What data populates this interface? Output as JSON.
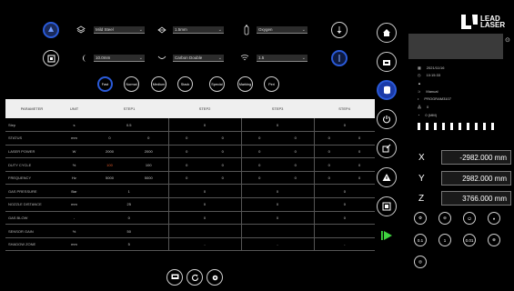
{
  "top_controls": {
    "row1": {
      "gas": "Mild Steel",
      "nozzle": "1.5mm",
      "cut_mode": "Oxygen"
    },
    "row2": {
      "thickness": "10.0mm",
      "type": "Carbon Double",
      "focus": "1.5"
    },
    "modes": [
      "Fast",
      "Normal",
      "Medium",
      "Stack",
      "Special",
      "Marking",
      "Peri"
    ]
  },
  "table": {
    "headers": [
      "PARAMETER",
      "UNIT",
      "STEP1",
      "STEP2",
      "STEP3",
      "STEP4"
    ],
    "rows": [
      {
        "name": "Step",
        "unit": "s",
        "v": [
          "0.5",
          "",
          "0",
          "",
          "0",
          "",
          "0",
          ""
        ]
      },
      {
        "name": "STATUS",
        "unit": "mm",
        "v": [
          "0",
          "0",
          "0",
          "0",
          "0",
          "0",
          "0",
          "0"
        ]
      },
      {
        "name": "LASER POWER",
        "unit": "W",
        "v": [
          "2000",
          "2000",
          "0",
          "0",
          "0",
          "0",
          "0",
          "0"
        ]
      },
      {
        "name": "DUTY CYCLE",
        "unit": "%",
        "v": [
          "100",
          "100",
          "0",
          "0",
          "0",
          "0",
          "0",
          "0"
        ]
      },
      {
        "name": "FREQUENCY",
        "unit": "Hz",
        "v": [
          "5000",
          "5000",
          "0",
          "0",
          "0",
          "0",
          "0",
          "0"
        ]
      },
      {
        "name": "GAS PRESSURE",
        "unit": "Bar",
        "v": [
          "1",
          "",
          "0",
          "",
          "0",
          "",
          "0",
          ""
        ]
      },
      {
        "name": "NOZZLE DISTANCE",
        "unit": "mm",
        "v": [
          "25",
          "",
          "0",
          "",
          "0",
          "",
          "0",
          ""
        ]
      },
      {
        "name": "GAS BLOW",
        "unit": "-",
        "v": [
          "0",
          "",
          "0",
          "",
          "0",
          "",
          "0",
          ""
        ]
      },
      {
        "name": "SENSOR GAIN",
        "unit": "%",
        "v": [
          "50",
          "",
          "",
          "",
          "",
          "",
          "",
          ""
        ]
      },
      {
        "name": "SHADOW ZONE",
        "unit": "mm",
        "v": [
          "5",
          "",
          "-",
          "",
          "-",
          "",
          "-",
          ""
        ]
      }
    ]
  },
  "logo": {
    "line1": "LEAD",
    "line2": "LASER"
  },
  "info": {
    "date": "2021/11/16",
    "time": "10:15:33",
    "mode": "Manual",
    "program": "PROGRAM3107",
    "count": "0",
    "counter_label": "0 (MM)"
  },
  "coords": {
    "x_label": "X",
    "x_value": "-2982.000 mm",
    "y_label": "Y",
    "y_value": "2982.000 mm",
    "z_label": "Z",
    "z_value": "3766.000 mm"
  },
  "step_buttons": [
    "0.1",
    "1",
    "0.01"
  ],
  "accent": "#2a5ad8",
  "highlight": "#e05a2a",
  "play_color": "#3fd43f"
}
